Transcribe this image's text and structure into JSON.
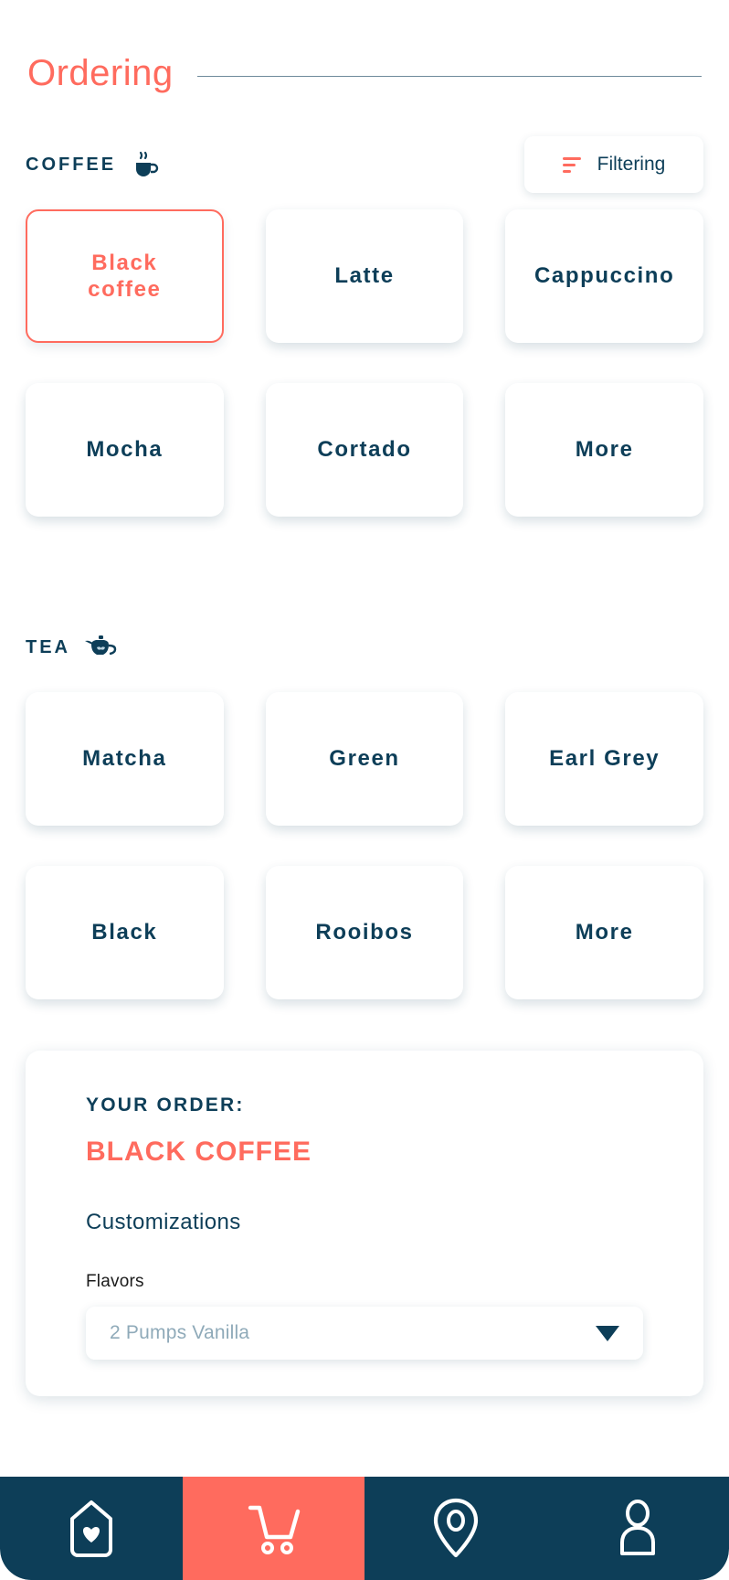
{
  "header": {
    "title": "Ordering"
  },
  "sections": [
    {
      "label": "COFFEE",
      "icon": "coffee-cup-icon",
      "filter": {
        "label": "Filtering",
        "icon": "filter-lines-icon"
      },
      "items": [
        {
          "label": "Black\ncoffee",
          "selected": true
        },
        {
          "label": "Latte",
          "selected": false
        },
        {
          "label": "Cappuccino",
          "selected": false
        },
        {
          "label": "Mocha",
          "selected": false
        },
        {
          "label": "Cortado",
          "selected": false
        },
        {
          "label": "More",
          "selected": false
        }
      ]
    },
    {
      "label": "TEA",
      "icon": "teapot-icon",
      "items": [
        {
          "label": "Matcha",
          "selected": false
        },
        {
          "label": "Green",
          "selected": false
        },
        {
          "label": "Earl Grey",
          "selected": false
        },
        {
          "label": "Black",
          "selected": false
        },
        {
          "label": "Rooibos",
          "selected": false
        },
        {
          "label": "More",
          "selected": false
        }
      ]
    }
  ],
  "order": {
    "heading": "YOUR ORDER:",
    "item": "BLACK COFFEE",
    "customizations_title": "Customizations",
    "flavors_label": "Flavors",
    "flavors_value": "2 Pumps Vanilla"
  },
  "bottom_nav": [
    {
      "name": "favorites-tag",
      "icon": "tag-heart-icon",
      "active": false
    },
    {
      "name": "cart",
      "icon": "shopping-cart-icon",
      "active": true
    },
    {
      "name": "locations",
      "icon": "location-pin-icon",
      "active": false
    },
    {
      "name": "profile",
      "icon": "person-icon",
      "active": false
    }
  ],
  "colors": {
    "accent": "#FF6B5E",
    "navy": "#0D3E58",
    "muted": "#8FAAB9",
    "rule": "#6E8A9B"
  }
}
